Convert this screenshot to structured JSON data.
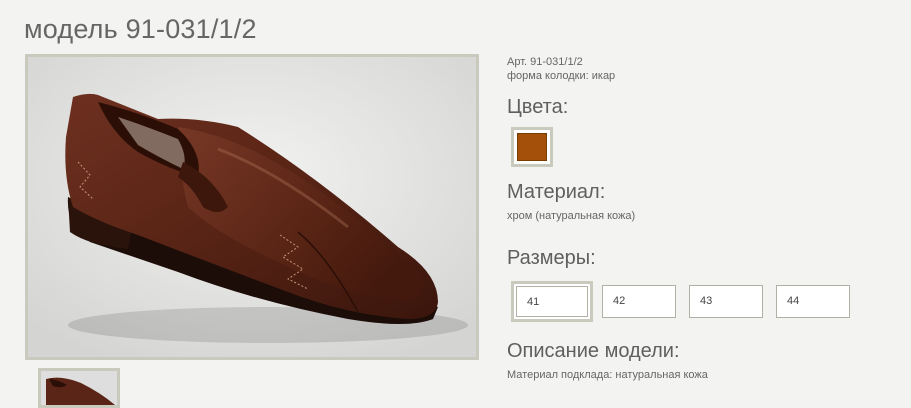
{
  "page": {
    "title": "модель 91-031/1/2"
  },
  "product": {
    "article": "Арт. 91-031/1/2",
    "last_form": "форма колодки: икар",
    "colors_heading": "Цвета:",
    "colors": [
      {
        "hex": "#a5500a"
      }
    ],
    "material_heading": "Материал:",
    "material_text": "хром (натуральная кожа)",
    "sizes_heading": "Размеры:",
    "sizes": [
      "41",
      "42",
      "43",
      "44"
    ],
    "selected_size": "41",
    "description_heading": "Описание модели:",
    "description_text": "Материал подклада: натуральная кожа"
  },
  "colors": {
    "frame": "#c9c9bd",
    "shoe_leather": "#5a2516"
  }
}
